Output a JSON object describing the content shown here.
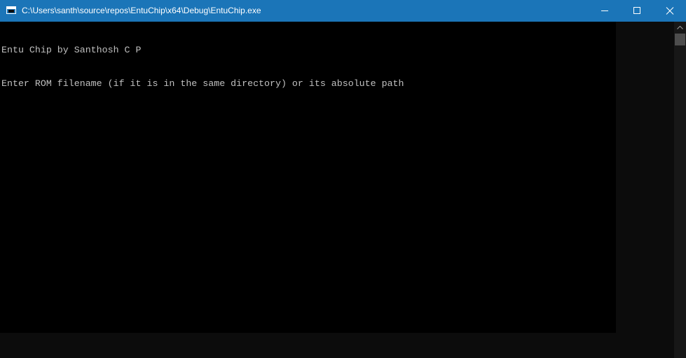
{
  "window": {
    "title": "C:\\Users\\santh\\source\\repos\\EntuChip\\x64\\Debug\\EntuChip.exe",
    "icon": "console-app-icon",
    "controls": {
      "minimize": "minimize-icon",
      "maximize": "maximize-icon",
      "close": "close-icon"
    }
  },
  "console": {
    "lines": [
      "Entu Chip by Santhosh C P",
      "Enter ROM filename (if it is in the same directory) or its absolute path"
    ]
  },
  "colors": {
    "titlebar": "#1b75b8",
    "console_background": "#000000",
    "console_text": "#c0c0c0",
    "scroll_thumb": "#4d4d4d"
  }
}
